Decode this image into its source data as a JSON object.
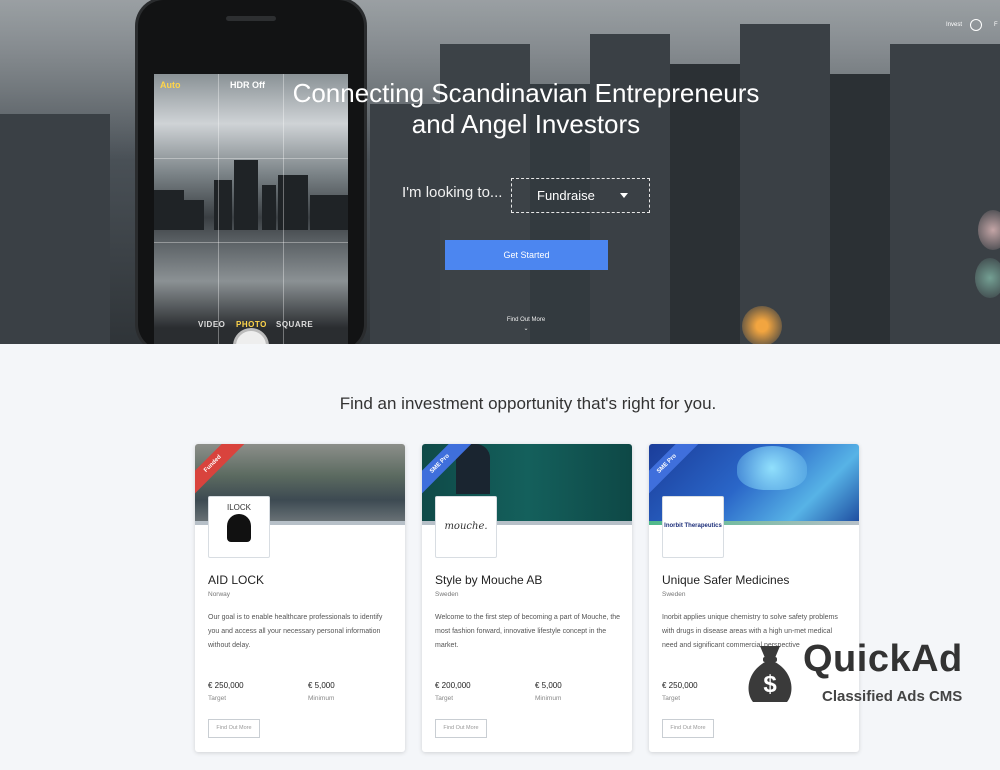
{
  "nav": {
    "login_label": "Invest",
    "more_label": "F"
  },
  "hero": {
    "title": "Connecting Scandinavian Entrepreneurs and Angel Investors",
    "looking_label": "I'm looking to...",
    "select_value": "Fundraise",
    "cta_label": "Get Started",
    "find_more_label": "Find Out More",
    "phone": {
      "flash_label": "Auto",
      "hdr_label": "HDR Off",
      "modes": [
        "VIDEO",
        "PHOTO",
        "SQUARE"
      ]
    }
  },
  "section": {
    "title": "Find an investment opportunity that's right for you."
  },
  "cards": [
    {
      "ribbon": "Funded",
      "ribbon_color": "#d9433d",
      "logo_text": "ILOCK",
      "name": "AID LOCK",
      "country": "Norway",
      "description": "Our goal is to enable healthcare professionals to identify you and access all your necessary personal information without delay.",
      "target_amount": "€ 250,000",
      "target_label": "Target",
      "minimum_amount": "€ 5,000",
      "minimum_label": "Minimum",
      "button_label": "Find Out More"
    },
    {
      "ribbon": "SME Pro",
      "ribbon_color": "#3f6fdc",
      "logo_text": "mouche.",
      "name": "Style by Mouche AB",
      "country": "Sweden",
      "description": "Welcome to the first step of becoming a part of Mouche, the most fashion forward, innovative lifestyle concept in the market.",
      "target_amount": "€ 200,000",
      "target_label": "Target",
      "minimum_amount": "€ 5,000",
      "minimum_label": "Minimum",
      "button_label": "Find Out More"
    },
    {
      "ribbon": "SME Pro",
      "ribbon_color": "#3f6fdc",
      "logo_text": "Inorbit Therapeutics",
      "name": "Unique Safer Medicines",
      "country": "Sweden",
      "description": "Inorbit applies unique chemistry to solve safety problems with drugs in disease areas with a high un-met medical need and significant commercial perspective",
      "target_amount": "€ 250,000",
      "target_label": "Target",
      "minimum_amount": "",
      "minimum_label": "",
      "button_label": "Find Out More"
    }
  ],
  "watermark": {
    "brand": "QuickAd",
    "tagline": "Classified Ads CMS",
    "icon": "money-bag-icon"
  },
  "colors": {
    "accent": "#4c86f0",
    "funded": "#d9433d",
    "sme_pro": "#3f6fdc"
  }
}
